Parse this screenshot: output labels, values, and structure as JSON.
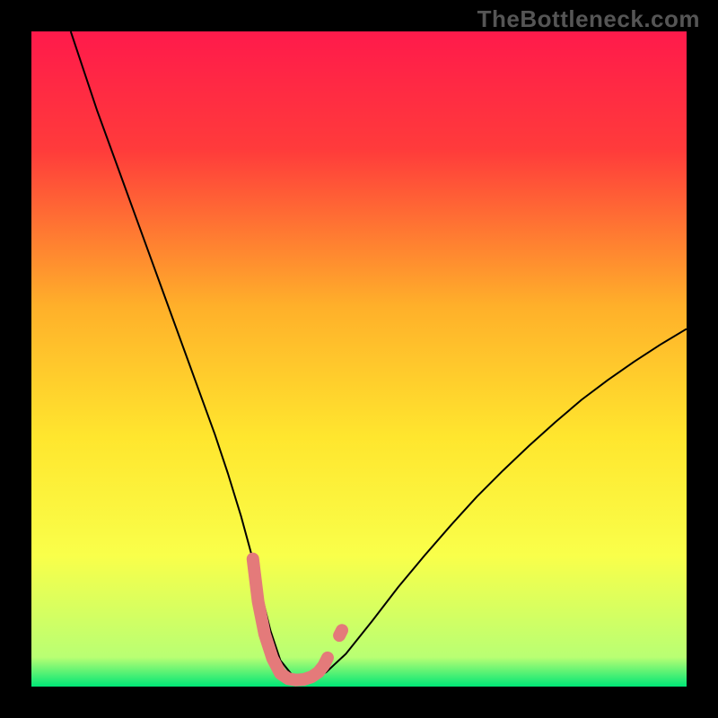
{
  "watermark": "TheBottleneck.com",
  "chart_data": {
    "type": "line",
    "title": "",
    "xlabel": "",
    "ylabel": "",
    "xlim": [
      0,
      100
    ],
    "ylim": [
      0,
      100
    ],
    "background_gradient_stops": [
      {
        "offset": 0.0,
        "color": "#ff1a4b"
      },
      {
        "offset": 0.18,
        "color": "#ff3b3b"
      },
      {
        "offset": 0.42,
        "color": "#ffb02a"
      },
      {
        "offset": 0.62,
        "color": "#ffe62e"
      },
      {
        "offset": 0.8,
        "color": "#f9ff4a"
      },
      {
        "offset": 0.955,
        "color": "#b9ff73"
      },
      {
        "offset": 1.0,
        "color": "#00e676"
      }
    ],
    "series": [
      {
        "name": "bottleneck-curve",
        "color": "#000000",
        "stroke_width": 2,
        "x": [
          6,
          8,
          10,
          12,
          14,
          16,
          18,
          20,
          22,
          24,
          26,
          28,
          30,
          32,
          33.5,
          35,
          36.5,
          38,
          40,
          41,
          43,
          45,
          48,
          52,
          56,
          60,
          64,
          68,
          72,
          76,
          80,
          84,
          88,
          92,
          96,
          100
        ],
        "y": [
          100,
          94,
          88,
          82.5,
          77,
          71.5,
          66,
          60.5,
          55,
          49.5,
          44,
          38.5,
          32.5,
          26,
          20.5,
          14.5,
          8.5,
          4,
          1.5,
          1.2,
          1.2,
          2.2,
          5,
          10,
          15.2,
          20,
          24.6,
          29,
          33,
          36.8,
          40.4,
          43.8,
          46.8,
          49.6,
          52.2,
          54.6
        ]
      },
      {
        "name": "highlight-band",
        "color": "#e47a7a",
        "stroke_width": 14,
        "linecap": "round",
        "x": [
          33.8,
          34.6,
          35.6,
          36.8,
          38.0,
          39.2,
          40.4,
          41.6,
          42.8,
          43.8,
          44.6,
          45.2
        ],
        "y": [
          19.5,
          13.0,
          8.0,
          4.3,
          2.0,
          1.2,
          1.0,
          1.1,
          1.5,
          2.2,
          3.2,
          4.4
        ]
      },
      {
        "name": "highlight-dot",
        "color": "#e47a7a",
        "stroke_width": 14,
        "linecap": "round",
        "x": [
          47.0,
          47.4
        ],
        "y": [
          7.8,
          8.6
        ]
      }
    ]
  }
}
